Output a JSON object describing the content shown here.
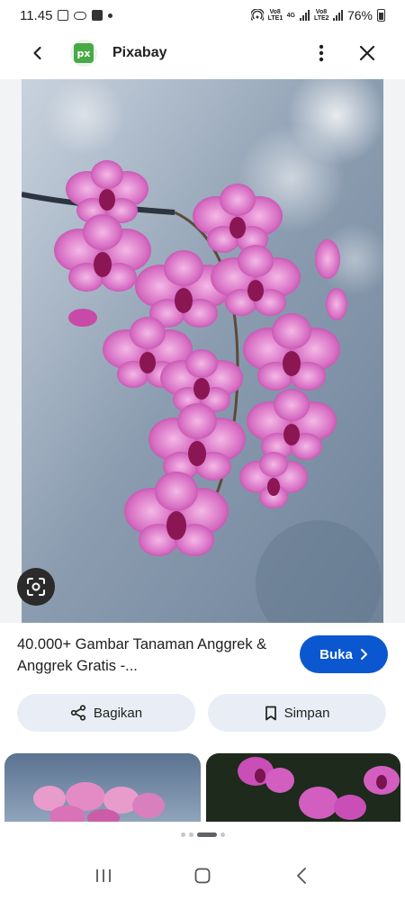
{
  "status_bar": {
    "time": "11.45",
    "battery": "76%",
    "volte1": "Vo8 LTE1",
    "volte2": "Vo8 LTE2",
    "network": "4G"
  },
  "app_bar": {
    "logo_text": "px",
    "title": "Pixabay"
  },
  "result": {
    "title": "40.000+ Gambar Tanaman Anggrek & Anggrek Gratis -...",
    "open_label": "Buka"
  },
  "actions": {
    "share_label": "Bagikan",
    "save_label": "Simpan"
  },
  "colors": {
    "primary_button": "#0b57d0",
    "tonal_button": "#e9eef6",
    "logo_green": "#48a947"
  },
  "icons": {
    "back": "arrow-back-icon",
    "more": "more-vert-icon",
    "close": "close-icon",
    "lens": "google-lens-icon",
    "open": "chevron-right-icon",
    "share": "share-icon",
    "save": "bookmark-icon",
    "recents": "recents-icon",
    "home": "home-icon",
    "nav_back": "nav-back-icon"
  },
  "pager": {
    "count": 4,
    "active_index": 1
  }
}
